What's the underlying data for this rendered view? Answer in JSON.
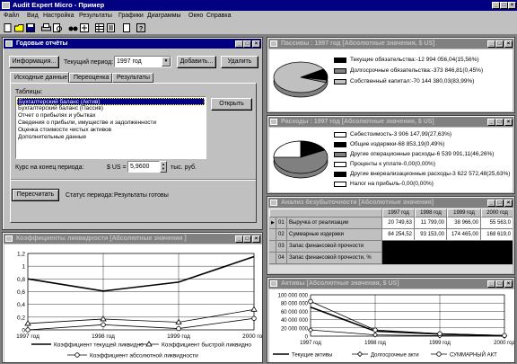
{
  "app": {
    "title": "Audit Expert Micro - Пример"
  },
  "menu": [
    "Файл",
    "Вид",
    "Настройка",
    "Результаты",
    "Графики",
    "Диаграммы",
    "Окно",
    "Справка"
  ],
  "reports_window": {
    "title": "Годовые отчёты",
    "info_button": "Информация...",
    "period_label": "Текущий период:",
    "period_value": "1997 год",
    "add_button": "Добавить...",
    "delete_button": "Удалить",
    "tabs": [
      "Исходные данные",
      "Переоценка",
      "Результаты"
    ],
    "tables_label": "Таблицы:",
    "tables": [
      "Бухгалтерский баланс (Актив)",
      "Бухгалтерский баланс (Пассив)",
      "Отчет о прибылях и убытках",
      "Сведения о прибыли, имуществе и задолженности",
      "Оценка стоимости чистых активов",
      "Дополнительные данные"
    ],
    "open_button": "Открыть",
    "rate_label": "Курс на конец периода:",
    "rate_prefix": "$ US =",
    "rate_value": "5,9600",
    "rate_unit": "тыс. руб.",
    "recalc_button": "Пересчитать",
    "status_label": "Статус периода:",
    "status_value": "Результаты готовы"
  },
  "passives_window": {
    "title": "Пассивы : 1997 год [Абсолютные значения, $ US]",
    "legend": [
      {
        "text": "Текущие обязательства:-12 994 056,04(15,56%)",
        "color": "#000000"
      },
      {
        "text": "Долгосрочные обязательства:-373 846,81(0,45%)",
        "color": "#808080"
      },
      {
        "text": "Собственный капитал:-70 144 380,03(83,99%)",
        "color": "#c0c0c0"
      }
    ]
  },
  "expenses_window": {
    "title": "Расходы : 1997 год [Абсолютные значения, $ US]",
    "legend": [
      {
        "text": "Себестоимость-3 906 147,99(27,63%)",
        "color": "#ffffff"
      },
      {
        "text": "Общие издержки-68 853,19(0,49%)",
        "color": "#000000"
      },
      {
        "text": "Другие операционные расходы-6 539 091,11(46,26%)",
        "color": "#808080"
      },
      {
        "text": "Проценты к уплате-0,00(0,00%)",
        "color": "#ffffff"
      },
      {
        "text": "Другие внереализационные расходы-3 622 572,48(25,63%)",
        "color": "#000000"
      },
      {
        "text": "Налог на прибыль-0,00(0,00%)",
        "color": "#ffffff"
      }
    ]
  },
  "breakeven_window": {
    "title": "Анализ безубыточности [Абсолютные значения]",
    "columns": [
      "",
      "1997 год",
      "1998 год",
      "1999 год",
      "2000 год"
    ],
    "rows": [
      {
        "id": "01",
        "name": "Выручка от реализации",
        "values": [
          "20 749,63",
          "11 799,00",
          "38 966,00",
          "55 563,0"
        ]
      },
      {
        "id": "02",
        "name": "Суммарные издержки",
        "values": [
          "84 254,52",
          "93 153,00",
          "174 465,00",
          "168 619,0"
        ]
      },
      {
        "id": "03",
        "name": "Запас финансовой прочности",
        "values": [
          "",
          "",
          "",
          ""
        ]
      },
      {
        "id": "04",
        "name": "Запас финансовой прочности, %",
        "values": [
          "",
          "",
          "",
          ""
        ]
      }
    ]
  },
  "liquidity_window": {
    "title": "Коэффициенты ликвидности [Абсолютные значения ]",
    "legend": [
      "Коэффициент текущей ликвидно",
      "Коэффициент быстрой ликвидно",
      "Коэффициент абсолютной ликвидности"
    ]
  },
  "assets_window": {
    "title": "Активы [Абсолютные значения, $ US]",
    "legend": [
      "Текущие активы",
      "Долгосрочные акти",
      "СУММАРНЫЙ АКТ"
    ]
  },
  "chart_data": [
    {
      "type": "line",
      "x": [
        "1997 год",
        "1998 год",
        "1999 год",
        "2000 год"
      ],
      "series": [
        {
          "name": "Коэффициент текущей ликвидно",
          "values": [
            0.8,
            0.61,
            0.75,
            1.15
          ]
        },
        {
          "name": "Коэффициент быстрой ликвидно",
          "values": [
            0.1,
            0.17,
            0.12,
            0.32
          ]
        },
        {
          "name": "Коэффициент абсолютной ликвидности",
          "values": [
            0.0,
            0.08,
            0.02,
            0.18
          ]
        }
      ],
      "ylim": [
        0,
        1.2
      ],
      "yticks": [
        "0",
        "0,2",
        "0,4",
        "0,6",
        "0,8",
        "1",
        "1,2"
      ],
      "grid": true,
      "legend_placement": "bottom"
    },
    {
      "type": "line",
      "x": [
        "1997 год",
        "1998 год",
        "1999 год",
        "2000 год"
      ],
      "series": [
        {
          "name": "Текущие активы",
          "values": [
            70000000,
            12000000,
            5000000,
            1000000
          ]
        },
        {
          "name": "Долгосрочные акти",
          "values": [
            15000000,
            3000000,
            1000000,
            500000
          ]
        },
        {
          "name": "СУММАРНЫЙ АКТ",
          "values": [
            84000000,
            15000000,
            6000000,
            1500000
          ]
        }
      ],
      "ylim": [
        0,
        100000000
      ],
      "yticks": [
        "0",
        "20 000 000",
        "40 000 000",
        "60 000 000",
        "80 000 000",
        "100 000 000"
      ],
      "grid": true,
      "legend_placement": "bottom"
    }
  ]
}
